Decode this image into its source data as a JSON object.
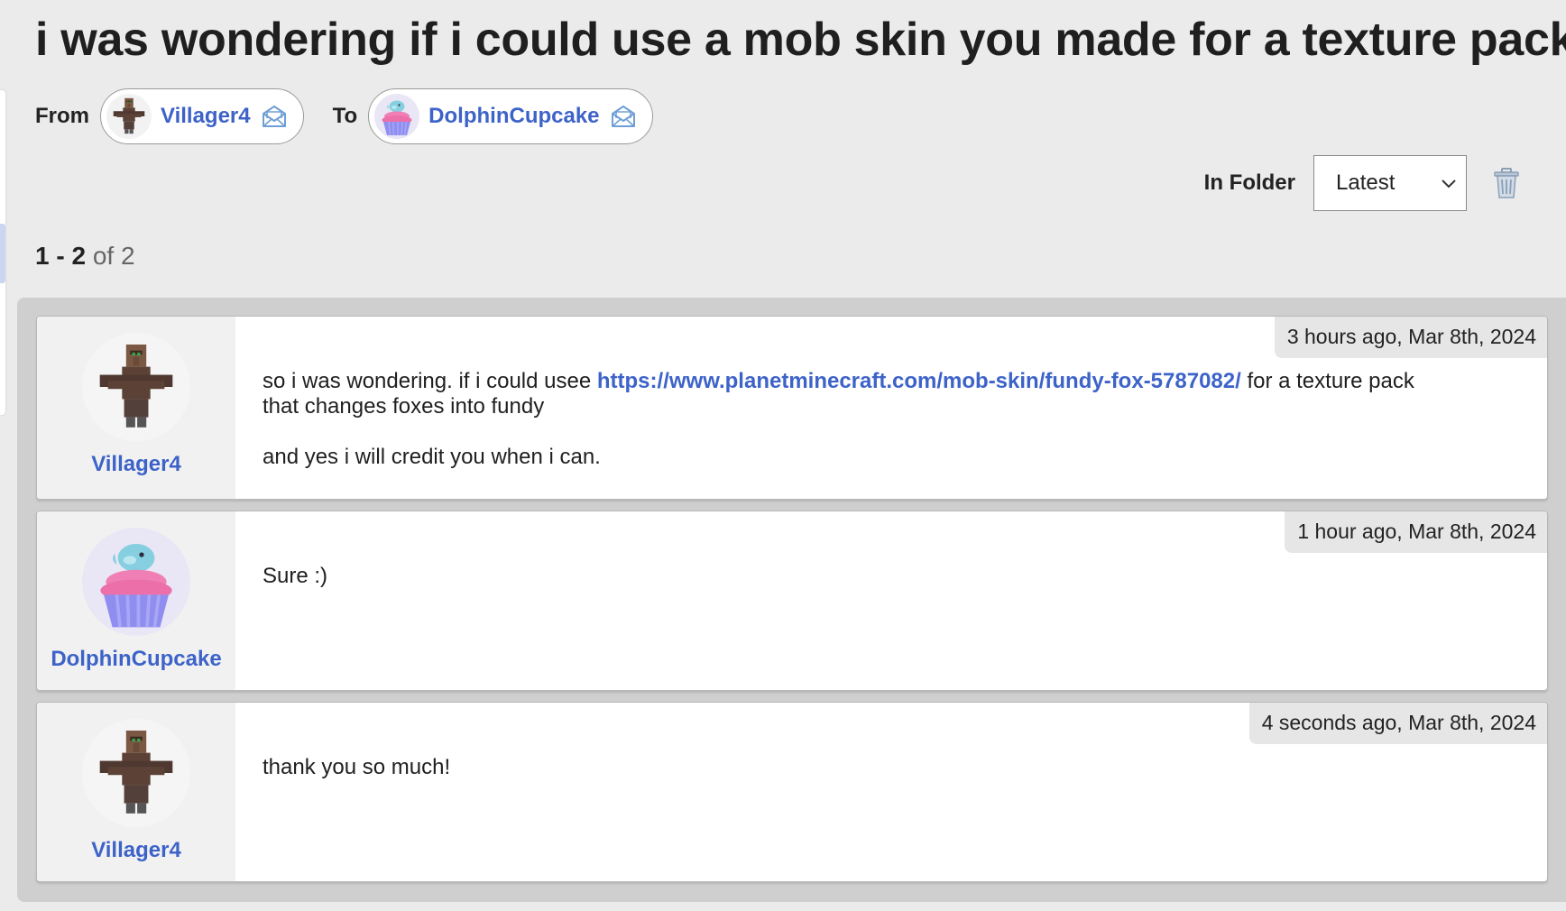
{
  "title": "i was wondering if i could use a mob skin you made for a texture pack.",
  "participants": {
    "from_label": "From",
    "to_label": "To",
    "from": {
      "name": "Villager4"
    },
    "to": {
      "name": "DolphinCupcake"
    }
  },
  "folder": {
    "label": "In Folder",
    "selected": "Latest"
  },
  "pagination": {
    "range": "1 - 2",
    "of_text": "of 2"
  },
  "colors": {
    "link": "#3d63c9",
    "background": "#ebebeb",
    "thread_bg": "#cfcfcf"
  },
  "messages": [
    {
      "author": "Villager4",
      "timestamp": "3 hours ago, Mar 8th, 2024",
      "text_before_link": "so i was wondering. if i could usee ",
      "link": "https://www.planetminecraft.com/mob-skin/fundy-fox-5787082/",
      "text_after_link": " for a texture pack that changes foxes into fundy",
      "paragraph2": "and yes i will credit you when i can."
    },
    {
      "author": "DolphinCupcake",
      "timestamp": "1 hour ago, Mar 8th, 2024",
      "text": "Sure :)"
    },
    {
      "author": "Villager4",
      "timestamp": "4 seconds ago, Mar 8th, 2024",
      "text": "thank you so much!"
    }
  ]
}
